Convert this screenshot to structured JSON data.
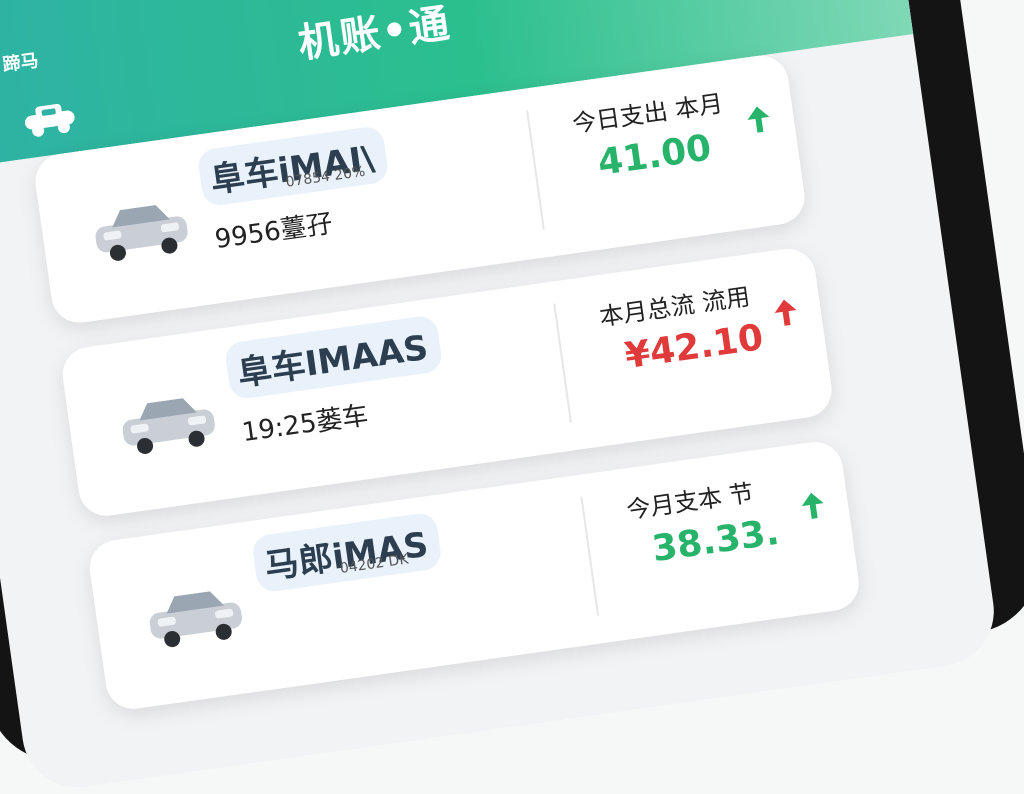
{
  "app": {
    "status_text": "蹄马",
    "title": "机账•通"
  },
  "colors": {
    "header_start": "#2fb1a6",
    "header_end": "#7fd8b6",
    "up_green": "#28b36b",
    "up_red": "#e03a3a"
  },
  "cards": [
    {
      "name": "阜车iMAI\\",
      "sub": "07854 20%",
      "meta": "9956薹孖",
      "right_label": "今日支出 本月",
      "right_value": "41.00",
      "trend_icon": "arrow-up-icon",
      "trend_color": "#28b36b"
    },
    {
      "name": "阜车IMAAS",
      "sub": "",
      "meta": "19:25蒌车",
      "right_label": "本月总流 流用",
      "right_value": "¥42.10",
      "trend_icon": "arrow-up-icon",
      "trend_color": "#e03a3a"
    },
    {
      "name": "马郎iMAS",
      "sub": "04202 DK",
      "meta": "",
      "right_label": "今月支本 节",
      "right_value": "38.33.",
      "trend_icon": "arrow-up-icon",
      "trend_color": "#28b36b"
    }
  ]
}
